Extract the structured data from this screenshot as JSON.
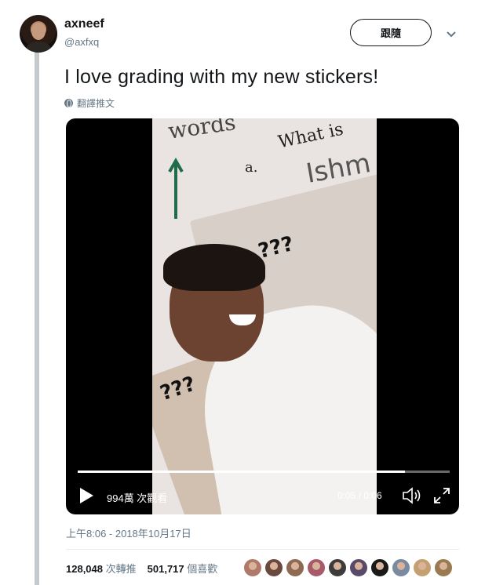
{
  "author": {
    "name": "axneef",
    "handle": "@axfxq",
    "avatar_icon": "profile-avatar"
  },
  "follow_label": "跟隨",
  "tweet": {
    "text": "I love grading with my new stickers!",
    "translate_label": "翻譯推文"
  },
  "video": {
    "views": "994萬 次觀看",
    "time": "0:05 / 0:06",
    "progress": 0.88,
    "frame_text": {
      "word1": "words",
      "word2": "What is",
      "letter": "a.",
      "handwriting": "Ishm",
      "qmarks": "???"
    }
  },
  "timestamp": "上午8:06 - 2018年10月17日",
  "stats": {
    "retweets": "128,048",
    "retweets_label": "次轉推",
    "likes": "501,717",
    "likes_label": "個喜歡"
  },
  "likers_count": 10,
  "colors": {
    "text": "#14171a",
    "secondary": "#657786",
    "thread_line": "#c4c9cd",
    "video_bg": "#000000"
  }
}
